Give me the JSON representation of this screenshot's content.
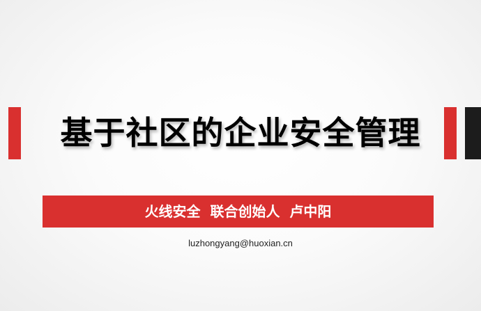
{
  "slide": {
    "title": "基于社区的企业安全管理",
    "subtitle": "火线安全  联合创始人  卢中阳",
    "email": "luzhongyang@huoxian.cn"
  },
  "colors": {
    "accent_red": "#d9302f",
    "accent_dark": "#1c1c1c",
    "title_text": "#000000",
    "subtitle_text": "#ffffff"
  }
}
